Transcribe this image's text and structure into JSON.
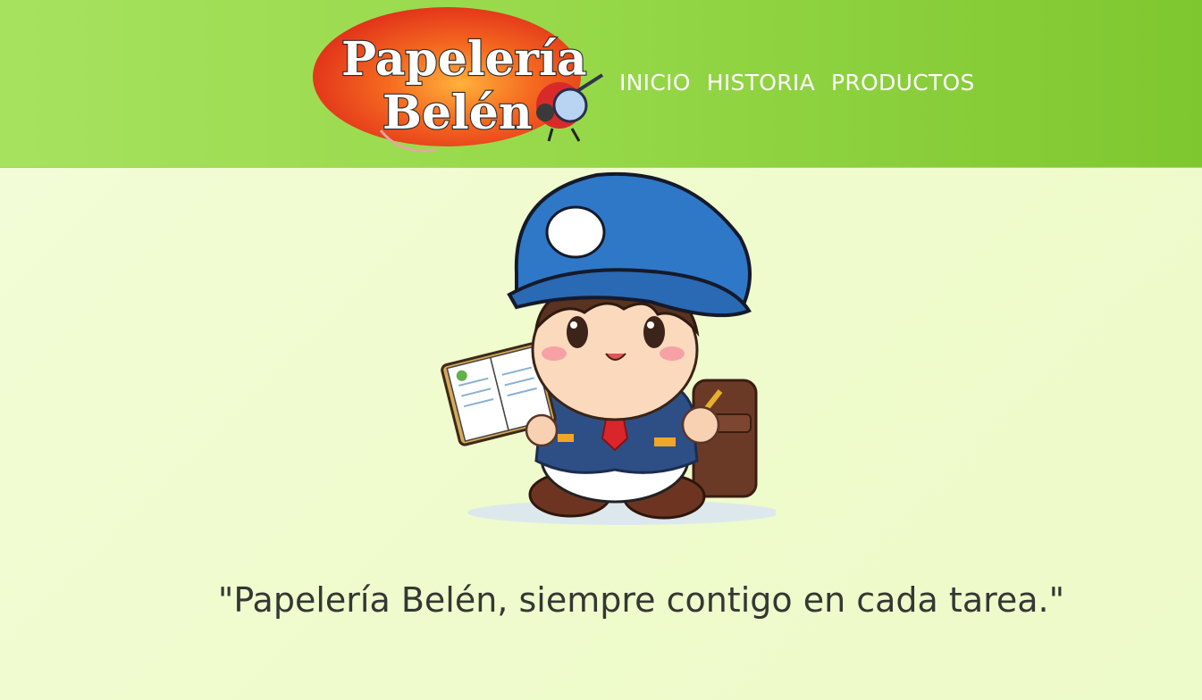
{
  "logo": {
    "line1": "Papelería",
    "line2": "Belén"
  },
  "nav": {
    "items": [
      {
        "label": "INICIO"
      },
      {
        "label": "HISTORIA"
      },
      {
        "label": "PRODUCTOS"
      }
    ]
  },
  "hero": {
    "slogan": "\"Papelería Belén, siempre contigo en cada tarea.\""
  },
  "colors": {
    "header": "#8fd43f",
    "background": "#effbcc",
    "logo_red": "#e83b1e",
    "mascot_blue": "#2f78c8",
    "slogan_text": "#333833"
  }
}
